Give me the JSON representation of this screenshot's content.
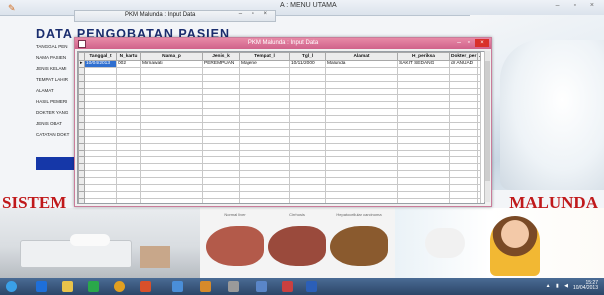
{
  "main_window": {
    "title": "A : MENU UTAMA",
    "controls": "– ▫ ×"
  },
  "behind_dialog": {
    "title": "PKM Malunda : Input Data",
    "controls": "– ▫ ×"
  },
  "form": {
    "title": "DATA  PENGOBATAN  PASIEN",
    "labels": [
      "TANGGAL PEN",
      "NAMA PASIEN",
      "JENIS KELAMI",
      "TEMPAT LAHIR",
      "ALAMAT",
      "HASIL PEMERI",
      "DOKTER YANG",
      "JENIS OBAT",
      "CATATAN DOKT"
    ]
  },
  "dialog": {
    "title": "PKM Malunda : Input Data",
    "close_label": "×",
    "min_label": "–",
    "max_label": "▫"
  },
  "table": {
    "headers": [
      "Tanggal_t",
      "N_kartu",
      "Nama_p",
      "Jenis_k",
      "Tempat_l",
      "Tgl_l",
      "Alamat",
      "H_periksa",
      "Dokter_per",
      "J"
    ],
    "rows": [
      [
        "10/04/2013",
        "002",
        "Mirnawati",
        "PEREMPUAN",
        "Majene",
        "10/11/2000",
        "Malunda",
        "SAKIT SEDANG",
        "dr ANUAD",
        ""
      ]
    ],
    "empty_rows": 24
  },
  "banner": {
    "left": "SISTEM",
    "right": "MALUNDA"
  },
  "photos": {
    "liver_captions": [
      "Normal liver",
      "Cirrhosis",
      "Hepatocellular carcinoma"
    ]
  },
  "taskbar": {
    "time": "15:27",
    "date": "10/04/2013",
    "tray": "▲ ▮ ◀"
  },
  "colors": {
    "dialog_title": "#d0628a",
    "banner_red": "#c0191b",
    "form_title": "#1a2d6e",
    "selection": "#2f6fd0"
  }
}
